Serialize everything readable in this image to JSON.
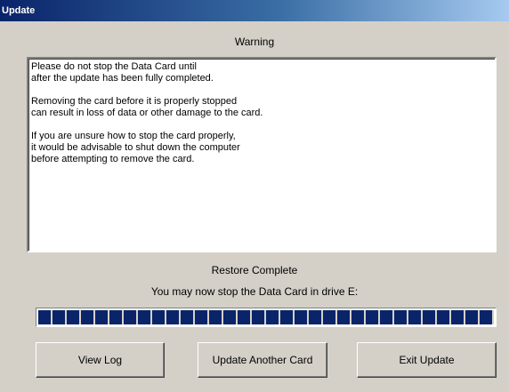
{
  "window": {
    "title": "Update"
  },
  "warning": {
    "heading": "Warning",
    "paragraphs": [
      [
        "Please do not stop the Data Card until",
        "after the update has been fully completed."
      ],
      [
        "Removing the card before it is properly stopped",
        "can result in loss of data or other damage to the card."
      ],
      [
        "If you are unsure how to stop the card properly,",
        "it would be advisable to shut down the computer",
        "before attempting to remove the card."
      ]
    ]
  },
  "status": {
    "title": "Restore Complete",
    "message": "You may now stop the Data Card in drive E:"
  },
  "progress": {
    "percent": 100
  },
  "buttons": {
    "view_log": "View Log",
    "update_another": "Update Another Card",
    "exit": "Exit Update"
  },
  "colors": {
    "title_bar": "#0a246a",
    "progress_fill": "#0a246a",
    "dialog_bg": "#d4d0c8"
  }
}
